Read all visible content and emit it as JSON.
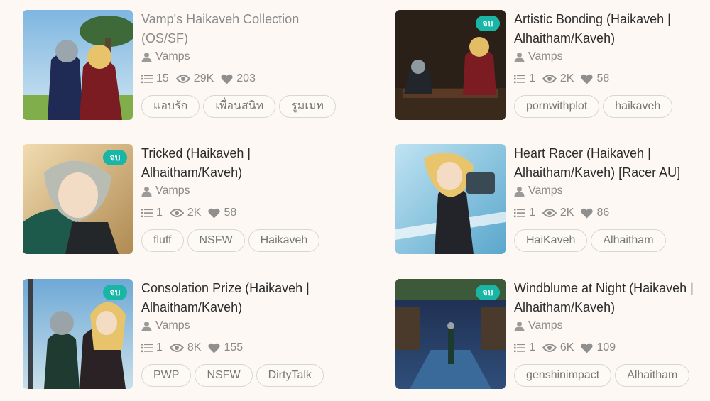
{
  "badge_label": "จบ",
  "stories": [
    {
      "title": "Vamp's Haikaveh Collection (OS/SF)",
      "author": "Vamps",
      "chapters": "15",
      "views": "29K",
      "likes": "203",
      "tags": [
        "แอบรัก",
        "เพื่อนสนิท",
        "รูมเมท"
      ]
    },
    {
      "title": "Artistic Bonding (Haikaveh | Alhaitham/Kaveh)",
      "author": "Vamps",
      "chapters": "1",
      "views": "2K",
      "likes": "58",
      "tags": [
        "pornwithplot",
        "haikaveh"
      ]
    },
    {
      "title": "Tricked (Haikaveh | Alhaitham/Kaveh)",
      "author": "Vamps",
      "chapters": "1",
      "views": "2K",
      "likes": "58",
      "tags": [
        "fluff",
        "NSFW",
        "Haikaveh"
      ]
    },
    {
      "title": "Heart Racer (Haikaveh | Alhaitham/Kaveh) [Racer AU]",
      "author": "Vamps",
      "chapters": "1",
      "views": "2K",
      "likes": "86",
      "tags": [
        "HaiKaveh",
        "Alhaitham"
      ]
    },
    {
      "title": "Consolation Prize (Haikaveh | Alhaitham/Kaveh)",
      "author": "Vamps",
      "chapters": "1",
      "views": "8K",
      "likes": "155",
      "tags": [
        "PWP",
        "NSFW",
        "DirtyTalk"
      ]
    },
    {
      "title": "Windblume at Night (Haikaveh | Alhaitham/Kaveh)",
      "author": "Vamps",
      "chapters": "1",
      "views": "6K",
      "likes": "109",
      "tags": [
        "genshinimpact",
        "Alhaitham"
      ]
    }
  ]
}
